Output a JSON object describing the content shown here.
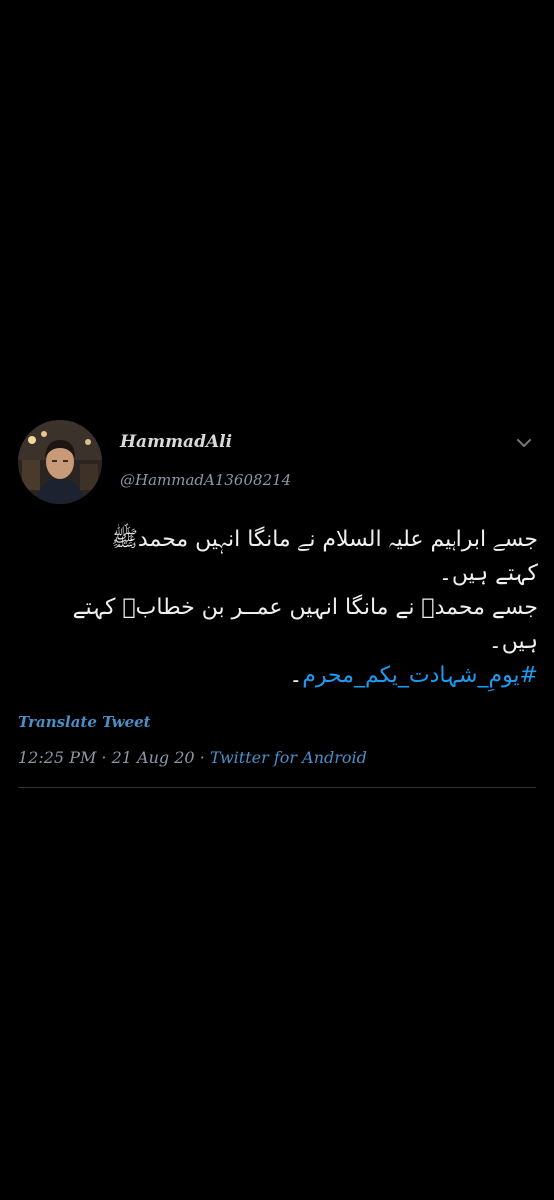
{
  "tweet": {
    "author_name": "HammadAli",
    "author_handle": "@HammadA13608214",
    "avatar_icon": "profile-photo",
    "menu_icon": "chevron-down-icon",
    "text_lines": [
      "جسے ابراہیم علیہ السلام نے مانگا انہیں محمدﷺ",
      "کہتے ہیں۔",
      "جسے محمدﷺ نے مانگا انہیں عمــر بن خطابؓ کہتے",
      "ہیں۔"
    ],
    "hashtag": "#یومِ_شہادت_یکم_محرم",
    "hashtag_suffix": "۔",
    "translate_label": "Translate Tweet",
    "time": "12:25 PM",
    "separator": " · ",
    "date": "21 Aug 20",
    "source": "Twitter for Android"
  },
  "colors": {
    "background": "#000000",
    "link": "#1d9bf0",
    "secondary_text": "#8b98a5",
    "divider": "#2f3336"
  }
}
